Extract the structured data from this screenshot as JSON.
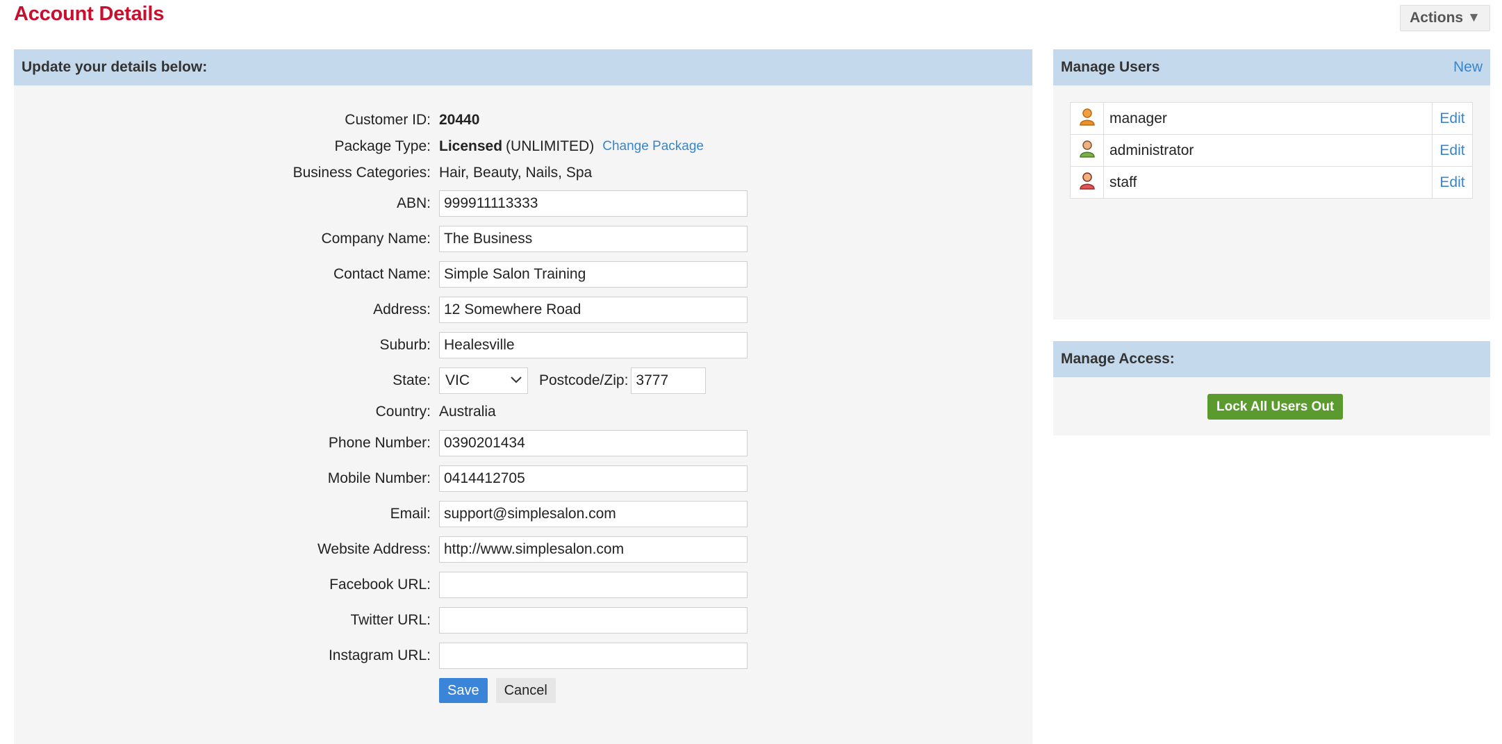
{
  "header": {
    "title": "Account Details",
    "actions_label": "Actions"
  },
  "details_panel": {
    "heading": "Update your details below:",
    "customer_id_label": "Customer ID:",
    "customer_id": "20440",
    "package_type_label": "Package Type:",
    "package_type": "Licensed",
    "package_detail": "(UNLIMITED)",
    "change_package_label": "Change Package",
    "business_categories_label": "Business Categories:",
    "business_categories": "Hair, Beauty, Nails, Spa",
    "abn_label": "ABN:",
    "abn": "999911113333",
    "company_name_label": "Company Name:",
    "company_name": "The Business",
    "contact_name_label": "Contact Name:",
    "contact_name": "Simple Salon Training",
    "address_label": "Address:",
    "address": "12 Somewhere Road",
    "suburb_label": "Suburb:",
    "suburb": "Healesville",
    "state_label": "State:",
    "state": "VIC",
    "postcode_label": "Postcode/Zip:",
    "postcode": "3777",
    "country_label": "Country:",
    "country": "Australia",
    "phone_label": "Phone Number:",
    "phone": "0390201434",
    "mobile_label": "Mobile Number:",
    "mobile": "0414412705",
    "email_label": "Email:",
    "email": "support@simplesalon.com",
    "website_label": "Website Address:",
    "website": "http://www.simplesalon.com",
    "facebook_label": "Facebook URL:",
    "facebook": "",
    "twitter_label": "Twitter URL:",
    "twitter": "",
    "instagram_label": "Instagram URL:",
    "instagram": "",
    "save_label": "Save",
    "cancel_label": "Cancel"
  },
  "users_panel": {
    "heading": "Manage Users",
    "new_label": "New",
    "users": [
      {
        "name": "manager",
        "edit_label": "Edit",
        "icon": "user-icon",
        "icon_color": "#e8922e"
      },
      {
        "name": "administrator",
        "edit_label": "Edit",
        "icon": "user-icon",
        "icon_color": "#7bb04a"
      },
      {
        "name": "staff",
        "edit_label": "Edit",
        "icon": "user-icon",
        "icon_color": "#dd5555"
      }
    ]
  },
  "access_panel": {
    "heading": "Manage Access:",
    "lock_label": "Lock All Users Out"
  },
  "colors": {
    "title": "#c8102e",
    "panel_header": "#c5d9ec",
    "link": "#3a85c9",
    "save_button": "#3a85d8",
    "lock_button": "#5a9a2f"
  }
}
